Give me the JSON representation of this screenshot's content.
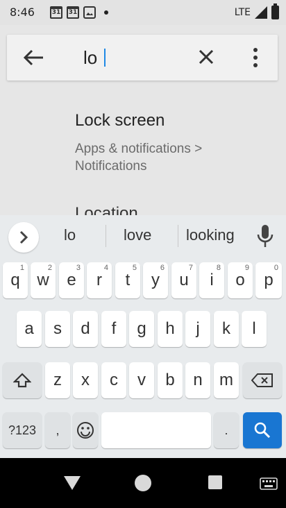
{
  "status_bar": {
    "time": "8:46",
    "network": "LTE",
    "calendar_1": "31",
    "calendar_2": "31"
  },
  "search": {
    "query": "lo",
    "placeholder": ""
  },
  "results": [
    {
      "title": "Lock screen",
      "summary": "Apps & notifications > Notifications"
    },
    {
      "title": "Location"
    }
  ],
  "keyboard": {
    "suggestions": [
      "lo",
      "love",
      "looking"
    ],
    "row1": [
      {
        "key": "q",
        "hint": "1"
      },
      {
        "key": "w",
        "hint": "2"
      },
      {
        "key": "e",
        "hint": "3"
      },
      {
        "key": "r",
        "hint": "4"
      },
      {
        "key": "t",
        "hint": "5"
      },
      {
        "key": "y",
        "hint": "6"
      },
      {
        "key": "u",
        "hint": "7"
      },
      {
        "key": "i",
        "hint": "8"
      },
      {
        "key": "o",
        "hint": "9"
      },
      {
        "key": "p",
        "hint": "0"
      }
    ],
    "row2": [
      "a",
      "s",
      "d",
      "f",
      "g",
      "h",
      "j",
      "k",
      "l"
    ],
    "row3": [
      "z",
      "x",
      "c",
      "v",
      "b",
      "n",
      "m"
    ],
    "symbols_label": "?123",
    "comma": ",",
    "period": "."
  },
  "colors": {
    "accent": "#1976d2",
    "cursor": "#1e88e5"
  },
  "icons": [
    "back-arrow-icon",
    "clear-icon",
    "more-vert-icon",
    "chevron-right-icon",
    "mic-icon",
    "shift-icon",
    "backspace-icon",
    "emoji-icon",
    "search-icon",
    "nav-back-icon",
    "nav-home-icon",
    "nav-recents-icon",
    "keyboard-switch-icon"
  ]
}
